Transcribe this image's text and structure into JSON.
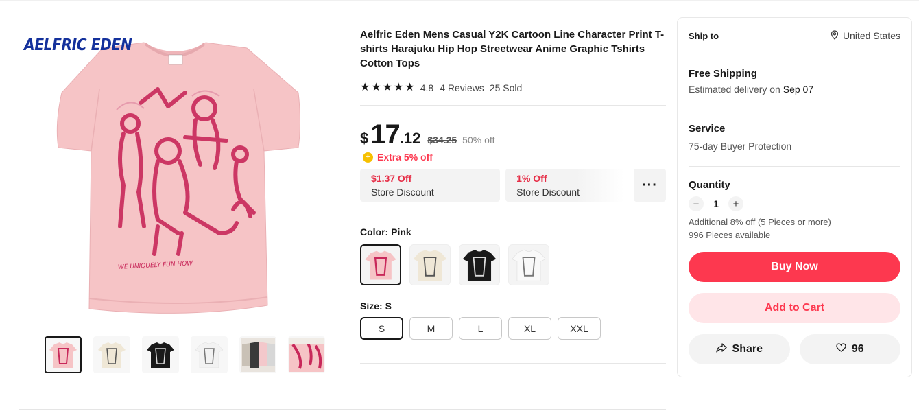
{
  "gallery": {
    "brand": "AELFRIC EDEN",
    "shirt_print_text": "WE UNIQUELY FUN HOW",
    "thumbnails": [
      "pink",
      "cream",
      "black",
      "white",
      "group",
      "detail"
    ]
  },
  "product": {
    "title": "Aelfric Eden Mens Casual Y2K Cartoon Line Character Print T-shirts Harajuku Hip Hop Streetwear Anime Graphic Tshirts Cotton Tops",
    "rating": "4.8",
    "reviews": "4 Reviews",
    "sold": "25 Sold",
    "stars": 5
  },
  "price": {
    "currency": "$",
    "integer": "17",
    "decimal": ".12",
    "original": "$34.25",
    "off": "50% off",
    "extra": "Extra 5% off",
    "coin_icon": "plus-coin-icon"
  },
  "coupons": [
    {
      "amount": "$1.37 Off",
      "label": "Store Discount"
    },
    {
      "amount": "1% Off",
      "label": "Store Discount"
    }
  ],
  "more_label": "···",
  "color": {
    "label": "Color: Pink",
    "options": [
      "Pink",
      "Cream",
      "Black",
      "White"
    ]
  },
  "size": {
    "label": "Size: S",
    "options": [
      "S",
      "M",
      "L",
      "XL",
      "XXL"
    ],
    "selected": "S"
  },
  "panel": {
    "ship_to_label": "Ship to",
    "ship_to_value": "United States",
    "shipping_title": "Free Shipping",
    "delivery_prefix": "Estimated delivery on ",
    "delivery_date": "Sep 07",
    "service_title": "Service",
    "service_value": "75-day Buyer Protection",
    "quantity_label": "Quantity",
    "quantity_minus": "−",
    "quantity_value": "1",
    "quantity_plus": "+",
    "bulk_note": "Additional 8% off (5 Pieces or more)",
    "available": "996 Pieces available",
    "buy_now": "Buy Now",
    "add_to_cart": "Add to Cart",
    "share": "Share",
    "wishlist_count": "96"
  },
  "colors": {
    "accent": "#fd384f",
    "accent_light": "#ffe5e8",
    "coupon_text": "#e62e47",
    "brand": "#14319c",
    "shirt_pink": "#f6c4c6",
    "print_magenta": "#c8285a"
  }
}
